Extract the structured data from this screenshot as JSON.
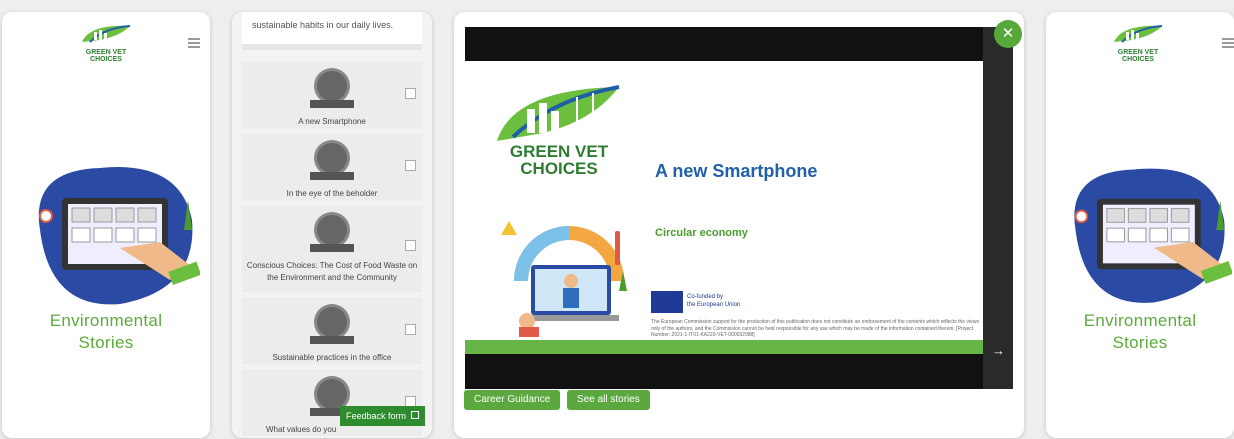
{
  "brand": {
    "name_line1": "GREEN VET",
    "name_line2": "CHOICES",
    "color": "#2e7d32"
  },
  "left_panel": {
    "title_line1": "Environmental",
    "title_line2": "Stories"
  },
  "right_panel": {
    "title_line1": "Environmental",
    "title_line2": "Stories"
  },
  "list_panel": {
    "intro_text": "sustainable habits in our daily lives.",
    "stories": [
      {
        "label": "A new Smartphone"
      },
      {
        "label": "In the eye of the beholder"
      },
      {
        "label": "Conscious Choices: The Cost of Food Waste on the Environment and the Community"
      },
      {
        "label": "Sustainable practices in the office"
      },
      {
        "label": "What values do you"
      }
    ],
    "feedback_label": "Feedback form"
  },
  "slide": {
    "title": "A new Smartphone",
    "subtitle": "Circular economy",
    "logo_line1": "GREEN VET",
    "logo_line2": "CHOICES",
    "eu_line1": "Co-funded by",
    "eu_line2": "the European Union",
    "disclaimer": "The European Commission support for the production of this publication does not constitute an endorsement of the contents which reflects the views only of the authors, and the Commission cannot be held responsible for any use which may be made of the information contained therein. [Project Number: 2021-1-IT01-KA220-VET-000032988]"
  },
  "buttons": {
    "career_guidance": "Career Guidance",
    "see_all": "See all stories"
  },
  "icons": {
    "close": "close-icon",
    "next": "arrow-right-icon",
    "menu": "hamburger-icon"
  },
  "colors": {
    "accent_green": "#5aa83e",
    "title_blue": "#2260a7"
  }
}
